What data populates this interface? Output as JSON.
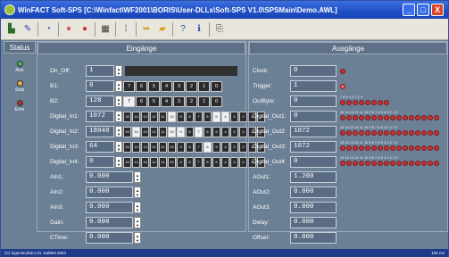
{
  "window": {
    "title": "WinFACT Soft-SPS [C:\\Winfact\\WF2001\\BORIS\\User-DLLs\\Soft-SPS V1.0\\SPSMain\\Demo.AWL]",
    "min": "_",
    "max": "□",
    "close": "X"
  },
  "status": {
    "header": "Status",
    "run": "Run",
    "stop": "Stop",
    "error": "Error",
    "run_color": "#4caf50",
    "stop_color": "#f0b23a",
    "error_color": "#b03030"
  },
  "inputs": {
    "header": "Eingänge",
    "on_off": {
      "label": "On_Off:",
      "value": "1"
    },
    "b1": {
      "label": "B1:",
      "value": "0",
      "bits": [
        "7",
        "6",
        "5",
        "4",
        "3",
        "2",
        "1",
        "0"
      ]
    },
    "b2": {
      "label": "B2:",
      "value": "128",
      "bits": [
        "7",
        "6",
        "5",
        "4",
        "3",
        "2",
        "1",
        "0"
      ]
    },
    "din1": {
      "label": "Digital_In1:",
      "value": "1072"
    },
    "din2": {
      "label": "Digital_In2:",
      "value": "18048"
    },
    "din3": {
      "label": "Digital_In3:",
      "value": "64"
    },
    "din4": {
      "label": "Digital_In4:",
      "value": "0"
    },
    "ain1": {
      "label": "AIn1:",
      "value": "0.000"
    },
    "ain2": {
      "label": "AIn2:",
      "value": "0.000"
    },
    "ain3": {
      "label": "AIn3:",
      "value": "0.000"
    },
    "gain": {
      "label": "Gain:",
      "value": "0.000"
    },
    "ctime": {
      "label": "CTime:",
      "value": "0.000"
    },
    "wordbits": [
      "15",
      "14",
      "13",
      "12",
      "11",
      "10",
      "9",
      "8",
      "7",
      "6",
      "5",
      "4",
      "3",
      "2",
      "1",
      "0"
    ]
  },
  "outputs": {
    "header": "Ausgänge",
    "clock": {
      "label": "Clock:",
      "value": "0"
    },
    "trigger": {
      "label": "Trigger:",
      "value": "1"
    },
    "outbyte": {
      "label": "OutByte:",
      "value": "0",
      "bits": "7 6 5 4 3 2 1 0"
    },
    "dout1": {
      "label": "Digital_Out1:",
      "value": "0"
    },
    "dout2": {
      "label": "Digital_Out2:",
      "value": "1072"
    },
    "dout3": {
      "label": "Digital_Out3:",
      "value": "1072"
    },
    "dout4": {
      "label": "Digital_Out4:",
      "value": "0"
    },
    "wordbits": "15 14 13 12 11 10 9 8 7 6 5 4 3 2 1 0",
    "aout1": {
      "label": "AOut1:",
      "value": "1.200"
    },
    "aout2": {
      "label": "AOut2:",
      "value": "0.000"
    },
    "aout3": {
      "label": "AOut3:",
      "value": "0.000"
    },
    "delay": {
      "label": "Delay:",
      "value": "0.000"
    },
    "offset": {
      "label": "Offset:",
      "value": "0.000"
    }
  },
  "statusbar": {
    "left": "(C) Ingenieurbüro Dr. Kahlert 2004",
    "right": "100 ms"
  }
}
